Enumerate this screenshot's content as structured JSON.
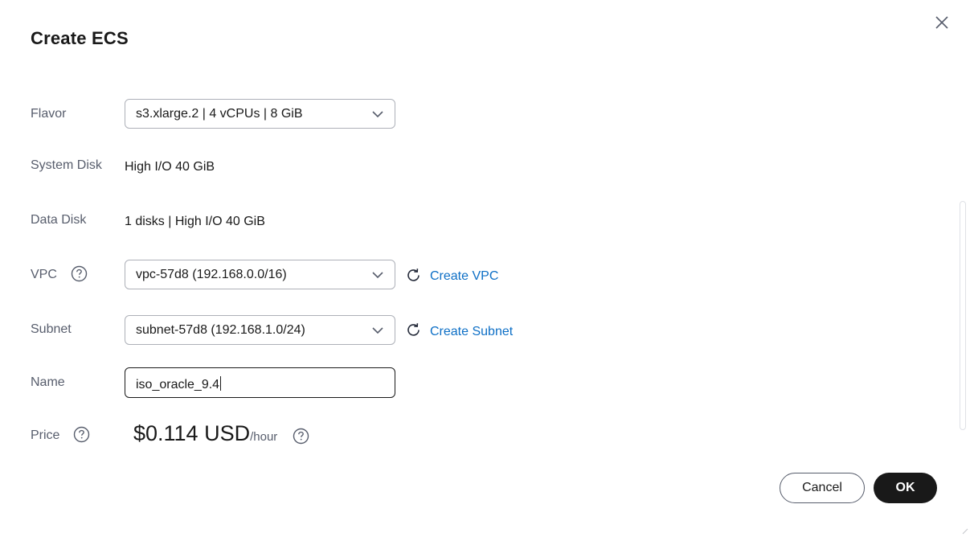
{
  "dialog": {
    "title": "Create ECS"
  },
  "form": {
    "flavor": {
      "label": "Flavor",
      "value": "s3.xlarge.2 | 4 vCPUs | 8 GiB"
    },
    "system_disk": {
      "label": "System Disk",
      "value": "High I/O 40 GiB"
    },
    "data_disk": {
      "label": "Data Disk",
      "value": "1 disks | High I/O 40 GiB"
    },
    "vpc": {
      "label": "VPC",
      "value": "vpc-57d8 (192.168.0.0/16)",
      "create_link": "Create VPC"
    },
    "subnet": {
      "label": "Subnet",
      "value": "subnet-57d8 (192.168.1.0/24)",
      "create_link": "Create Subnet"
    },
    "name": {
      "label": "Name",
      "value": "iso_oracle_9.4"
    },
    "price": {
      "label": "Price",
      "amount": "$0.114 USD",
      "unit": "/hour"
    }
  },
  "footer": {
    "cancel_label": "Cancel",
    "ok_label": "OK"
  },
  "icons": {
    "close": "close-icon",
    "help": "question-circle-icon",
    "chevron": "chevron-down-icon",
    "refresh": "refresh-icon"
  },
  "colors": {
    "link": "#0d6fc6",
    "primary_button": "#191919",
    "label": "#575d6c",
    "text": "#191919"
  }
}
